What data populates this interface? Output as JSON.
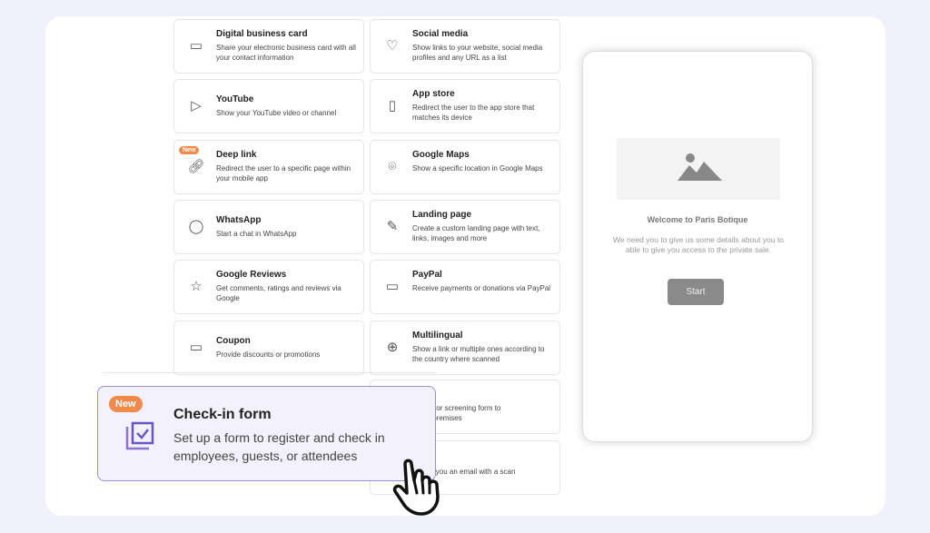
{
  "cards": [
    {
      "title": "Digital business card",
      "desc": "Share your electronic business card with all your contact information",
      "icon": "id-card-icon"
    },
    {
      "title": "Social media",
      "desc": "Show links to your website, social media profiles and any URL as a list",
      "icon": "heart-icon"
    },
    {
      "title": "YouTube",
      "desc": "Show your YouTube video or channel",
      "icon": "play-icon"
    },
    {
      "title": "App store",
      "desc": "Redirect the user to the app store that matches its device",
      "icon": "phone-download-icon"
    },
    {
      "title": "Deep link",
      "desc": "Redirect the user to a specific page within your mobile app",
      "icon": "link-icon",
      "badge": "New"
    },
    {
      "title": "Google Maps",
      "desc": "Show a specific location in Google Maps",
      "icon": "map-pin-icon"
    },
    {
      "title": "WhatsApp",
      "desc": "Start a chat in WhatsApp",
      "icon": "whatsapp-icon"
    },
    {
      "title": "Landing page",
      "desc": "Create a custom landing page with text, links, images and more",
      "icon": "edit-icon"
    },
    {
      "title": "Google Reviews",
      "desc": "Get comments, ratings and reviews via Google",
      "icon": "review-star-icon"
    },
    {
      "title": "PayPal",
      "desc": "Receive payments or donations via PayPal",
      "icon": "credit-card-icon"
    },
    {
      "title": "Coupon",
      "desc": "Provide discounts or promotions",
      "icon": "ticket-icon"
    },
    {
      "title": "Multilingual",
      "desc": "Show a link or multiple ones according to the country where scanned",
      "icon": "globe-icon"
    }
  ],
  "partial_cards": [
    {
      "title": "form",
      "desc": "tracing or screening form to\nt your premises"
    },
    {
      "title": "",
      "desc": "s send you an email with a scan"
    }
  ],
  "phone": {
    "welcome": "Welcome to Paris Botique",
    "desc": "We need you to give us some details about you to able to give you access to the private sale.",
    "button": "Start"
  },
  "highlight": {
    "badge": "New",
    "title": "Check-in form",
    "desc": "Set up a form to register and check in employees, guests, or attendees",
    "icon": "checklist-icon"
  },
  "colors": {
    "accent": "#9b8ad8",
    "badge": "#f08a4b"
  }
}
